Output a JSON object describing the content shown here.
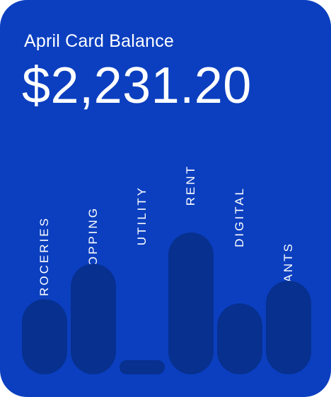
{
  "card": {
    "title": "April Card Balance",
    "balance": "$2,231.20",
    "background_color": "#0b3fbf",
    "bar_color": "#07308f",
    "text_color": "#ffffff"
  },
  "categories": [
    {
      "label": "GROCERIES",
      "relative_amount": 0.53
    },
    {
      "label": "SHOPPING",
      "relative_amount": 0.78
    },
    {
      "label": "UTILITY",
      "relative_amount": 0.1
    },
    {
      "label": "RENT",
      "relative_amount": 1.0
    },
    {
      "label": "DIGITAL",
      "relative_amount": 0.5
    },
    {
      "label": "RESTAURANTS",
      "relative_amount": 0.66
    }
  ]
}
